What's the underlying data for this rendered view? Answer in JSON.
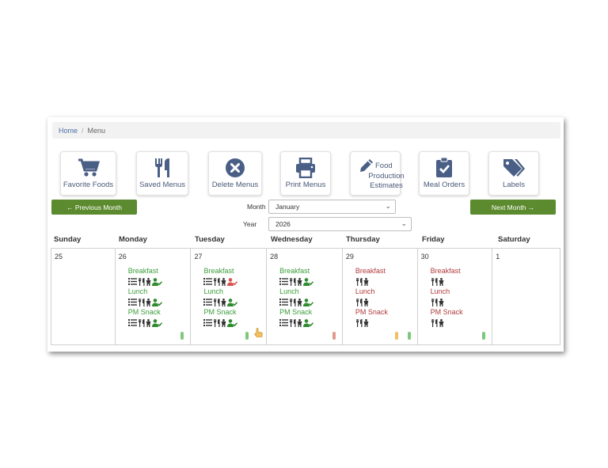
{
  "breadcrumb": {
    "home": "Home",
    "separator": "/",
    "current": "Menu"
  },
  "tiles": {
    "favorite_foods": "Favorite Foods",
    "saved_menus": "Saved Menus",
    "delete_menus": "Delete Menus",
    "print_menus": "Print Menus",
    "food_production_l1": "Food",
    "food_production_l2": "Production",
    "food_production_l3": "Estimates",
    "meal_orders": "Meal Orders",
    "labels": "Labels"
  },
  "nav": {
    "prev": "← Previous Month",
    "next": "Next Month →"
  },
  "filters": {
    "month_label": "Month",
    "month_value": "January",
    "year_label": "Year",
    "year_value": "2026"
  },
  "days": [
    "Sunday",
    "Monday",
    "Tuesday",
    "Wednesday",
    "Thursday",
    "Friday",
    "Saturday"
  ],
  "cells": [
    {
      "date": "25"
    },
    {
      "date": "26",
      "m1": "Breakfast",
      "m2": "Lunch",
      "m3": "PM Snack"
    },
    {
      "date": "27",
      "m1": "Breakfast",
      "m2": "Lunch",
      "m3": "PM Snack"
    },
    {
      "date": "28",
      "m1": "Breakfast",
      "m2": "Lunch",
      "m3": "PM Snack"
    },
    {
      "date": "29",
      "m1": "Breakfast",
      "m2": "Lunch",
      "m3": "PM Snack"
    },
    {
      "date": "30",
      "m1": "Breakfast",
      "m2": "Lunch",
      "m3": "PM Snack"
    },
    {
      "date": "1"
    }
  ],
  "colors": {
    "accent_green": "#5c8a2e",
    "meal_green": "#3a9c3a",
    "meal_red": "#b13a3a",
    "icon_blue": "#4a5f86",
    "status_red": "#d9534f"
  },
  "icons": [
    "cart-icon",
    "utensils-icon",
    "circle-x-icon",
    "printer-icon",
    "pencil-icon",
    "clipboard-check-icon",
    "tags-icon",
    "list-icon",
    "child-icon",
    "user-check-icon"
  ]
}
